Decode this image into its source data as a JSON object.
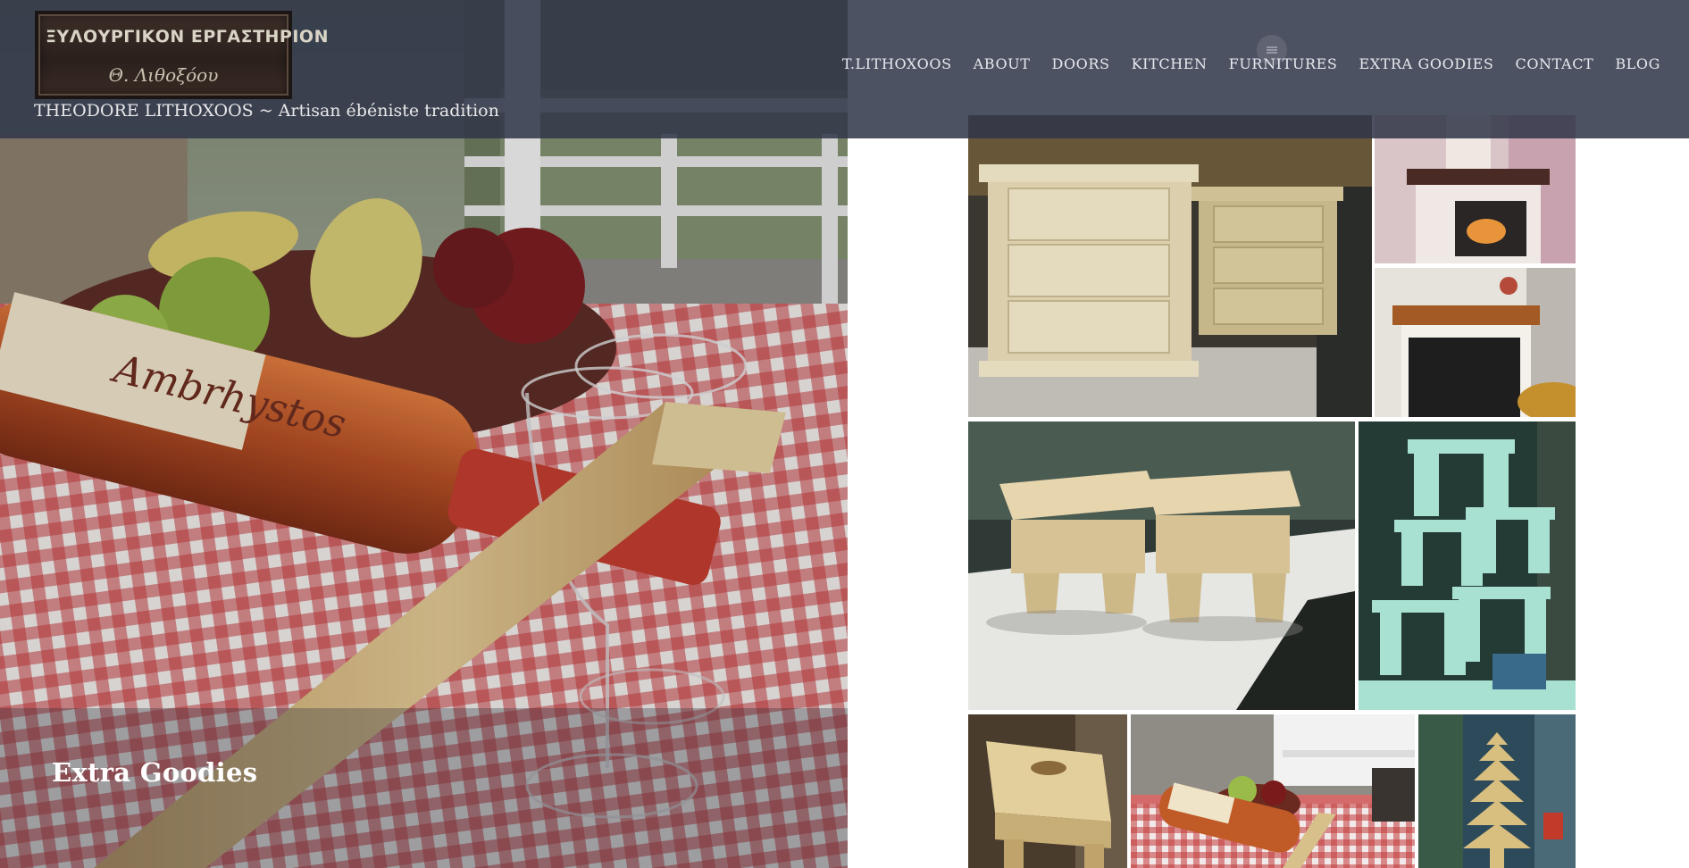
{
  "site": {
    "logo_text_line1": "ΞΥΛΟΥΡΓΙΚΟΝ ΕΡΓΑΣΤΗΡΙΟΝ",
    "logo_text_line2": "Θ. Λιθοξόου",
    "tagline": "THEODORE LITHOXOOS ~ Artisan ébéniste tradition"
  },
  "nav": {
    "items": [
      {
        "label": "T.LITHOXOOS"
      },
      {
        "label": "ABOUT"
      },
      {
        "label": "DOORS"
      },
      {
        "label": "KITCHEN"
      },
      {
        "label": "FURNITURES"
      },
      {
        "label": "EXTRA GOODIES"
      },
      {
        "label": "CONTACT"
      },
      {
        "label": "BLOG"
      }
    ],
    "menu_icon": "menu-icon"
  },
  "hero": {
    "caption": "Extra Goodies",
    "bottle_label": "Ambrhystos"
  },
  "gallery": {
    "items": [
      {
        "subject": "nightstands"
      },
      {
        "subject": "fireplace"
      },
      {
        "subject": "fireplace-mantel"
      },
      {
        "subject": "stools"
      },
      {
        "subject": "stacked-stools"
      },
      {
        "subject": "wooden-bench"
      },
      {
        "subject": "wine-holder"
      },
      {
        "subject": "wooden-tree"
      }
    ]
  },
  "colors": {
    "header_overlay": "#303648",
    "nav_text": "#e8e9ee",
    "accent_wood": "#d8c08a"
  }
}
